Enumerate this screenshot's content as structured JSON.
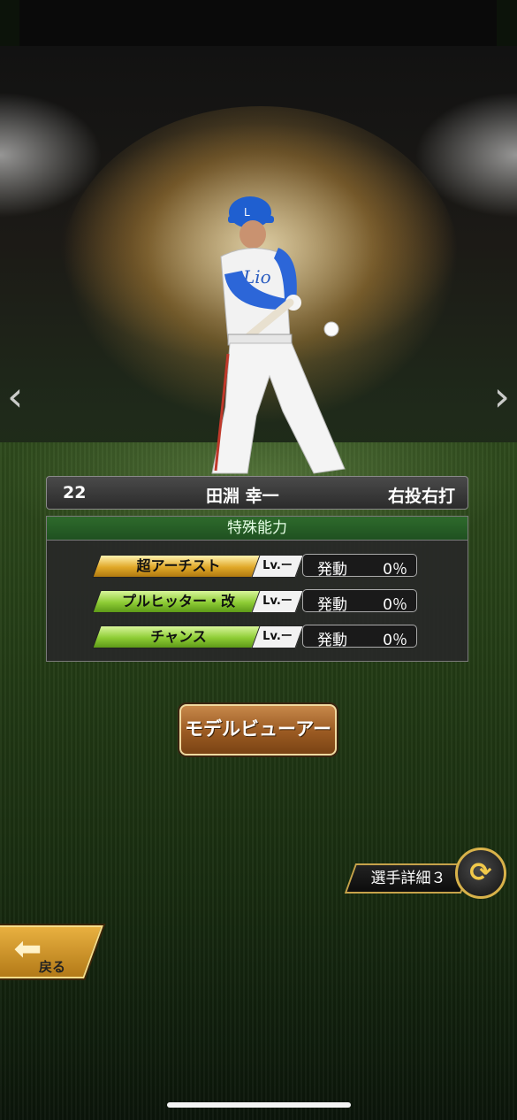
{
  "player": {
    "number": "22",
    "name": "田淵 幸一",
    "handedness": "右投右打",
    "cap_logo": "L",
    "jersey_text": "Lio"
  },
  "abilities": {
    "header": "特殊能力",
    "items": [
      {
        "name": "超アーチスト",
        "badge": "超",
        "level": "Lv.ー",
        "activation_label": "発動",
        "activation_value": "0％",
        "color": "#e0a828"
      },
      {
        "name": "プルヒッター・改",
        "level": "Lv.ー",
        "activation_label": "発動",
        "activation_value": "0％",
        "color": "#8dcc34"
      },
      {
        "name": "チャンス",
        "level": "Lv.ー",
        "activation_label": "発動",
        "activation_value": "0％",
        "color": "#8dcc34"
      }
    ]
  },
  "buttons": {
    "model_viewer": "モデルビューアー",
    "player_detail": "選手詳細３",
    "back": "戻る"
  },
  "nav": {
    "prev_icon": "chevron-left-icon",
    "next_icon": "chevron-right-icon",
    "swap_icon": "swap-arrows-icon"
  }
}
